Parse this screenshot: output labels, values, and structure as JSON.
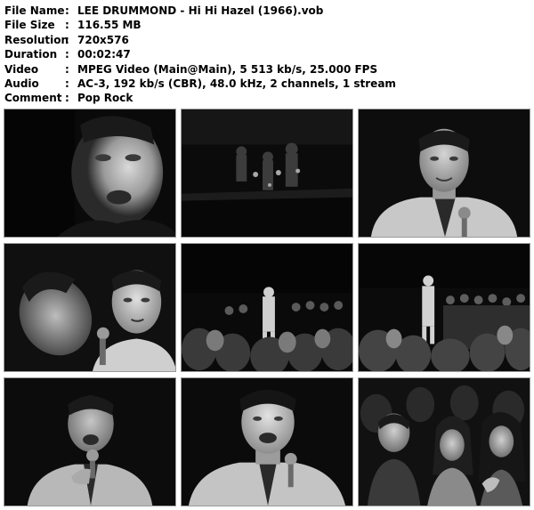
{
  "info": [
    {
      "key": "File Name",
      "sep": ":",
      "value": "LEE DRUMMOND - Hi Hi Hazel (1966).vob"
    },
    {
      "key": "File Size",
      "sep": ":",
      "value": "116.55 MB"
    },
    {
      "key": "Resolution",
      "sep": ":",
      "value": "720x576"
    },
    {
      "key": "Duration",
      "sep": ":",
      "value": "00:02:47"
    },
    {
      "key": "Video",
      "sep": ":",
      "value": "MPEG Video (Main@Main), 5 513 kb/s, 25.000 FPS"
    },
    {
      "key": "Audio",
      "sep": ":",
      "value": "AC-3, 192 kb/s (CBR), 48.0 kHz, 2 channels, 1 stream"
    },
    {
      "key": "Comment",
      "sep": ":",
      "value": "Pop Rock"
    }
  ],
  "thumbnails": [
    {
      "subject": "singer-closeup-face"
    },
    {
      "subject": "dark-stage-band"
    },
    {
      "subject": "singer-with-microphone"
    },
    {
      "subject": "two-faces-closeup"
    },
    {
      "subject": "singer-on-stage-crowd"
    },
    {
      "subject": "singer-on-stage-crowd-side"
    },
    {
      "subject": "singer-singing-microphone"
    },
    {
      "subject": "singer-smiling-microphone"
    },
    {
      "subject": "audience-girls"
    }
  ]
}
